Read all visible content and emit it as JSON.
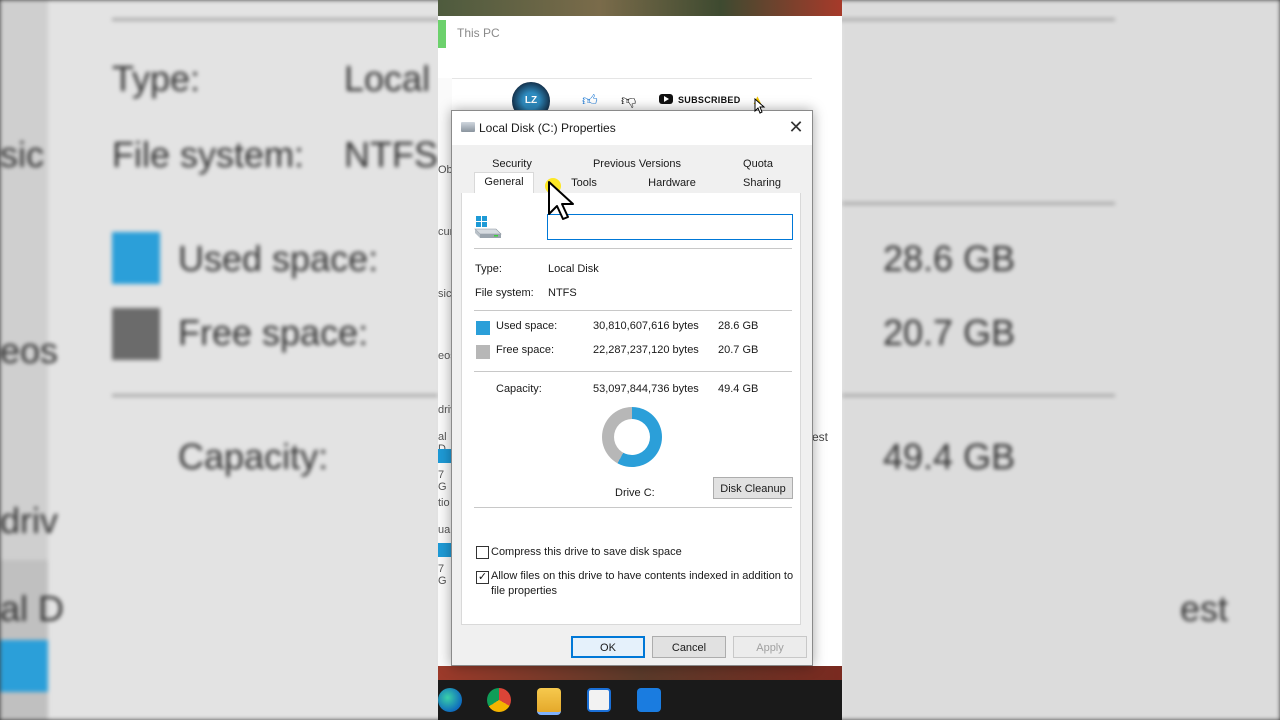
{
  "background": {
    "type_label": "Type:",
    "type_value": "Local D",
    "fs_label": "File system:",
    "fs_value": "NTFS",
    "used_label": "Used space:",
    "used_value": "28.6 GB",
    "free_label": "Free space:",
    "free_value": "20.7 GB",
    "capacity_label": "Capacity:",
    "capacity_value": "49.4 GB",
    "left_fragments": [
      "sic",
      "eos",
      "driv",
      "al D"
    ],
    "right_fragment": "est"
  },
  "explorer": {
    "title": "This PC",
    "left_fragments": [
      "Ob",
      "cun",
      "sic",
      "eos",
      "driv",
      "al D",
      "7 G",
      "tio",
      "ual",
      "7 G"
    ],
    "right_fragment": "est"
  },
  "overlay": {
    "avatar_text": "LZ",
    "subscribed_label": "SUBSCRIBED"
  },
  "dialog": {
    "title": "Local Disk (C:) Properties",
    "tabs_row1": [
      "Security",
      "Previous Versions",
      "Quota"
    ],
    "tabs_row2": [
      "General",
      "Tools",
      "Hardware",
      "Sharing"
    ],
    "name_value": "",
    "type_label": "Type:",
    "type_value": "Local Disk",
    "fs_label": "File system:",
    "fs_value": "NTFS",
    "used_label": "Used space:",
    "used_bytes": "30,810,607,616 bytes",
    "used_gb": "28.6 GB",
    "free_label": "Free space:",
    "free_bytes": "22,287,237,120 bytes",
    "free_gb": "20.7 GB",
    "capacity_label": "Capacity:",
    "capacity_bytes": "53,097,844,736 bytes",
    "capacity_gb": "49.4 GB",
    "drive_label": "Drive C:",
    "cleanup_label": "Disk Cleanup",
    "compress_label": "Compress this drive to save disk space",
    "compress_checked": false,
    "index_label_1": "Allow files on this drive to have contents indexed in addition to",
    "index_label_2": "file properties",
    "index_checked": true,
    "ok_label": "OK",
    "cancel_label": "Cancel",
    "apply_label": "Apply",
    "used_fraction": 0.5802,
    "colors": {
      "used": "#2b9fd9",
      "free": "#b7b7b7",
      "accent": "#0078d7"
    }
  }
}
